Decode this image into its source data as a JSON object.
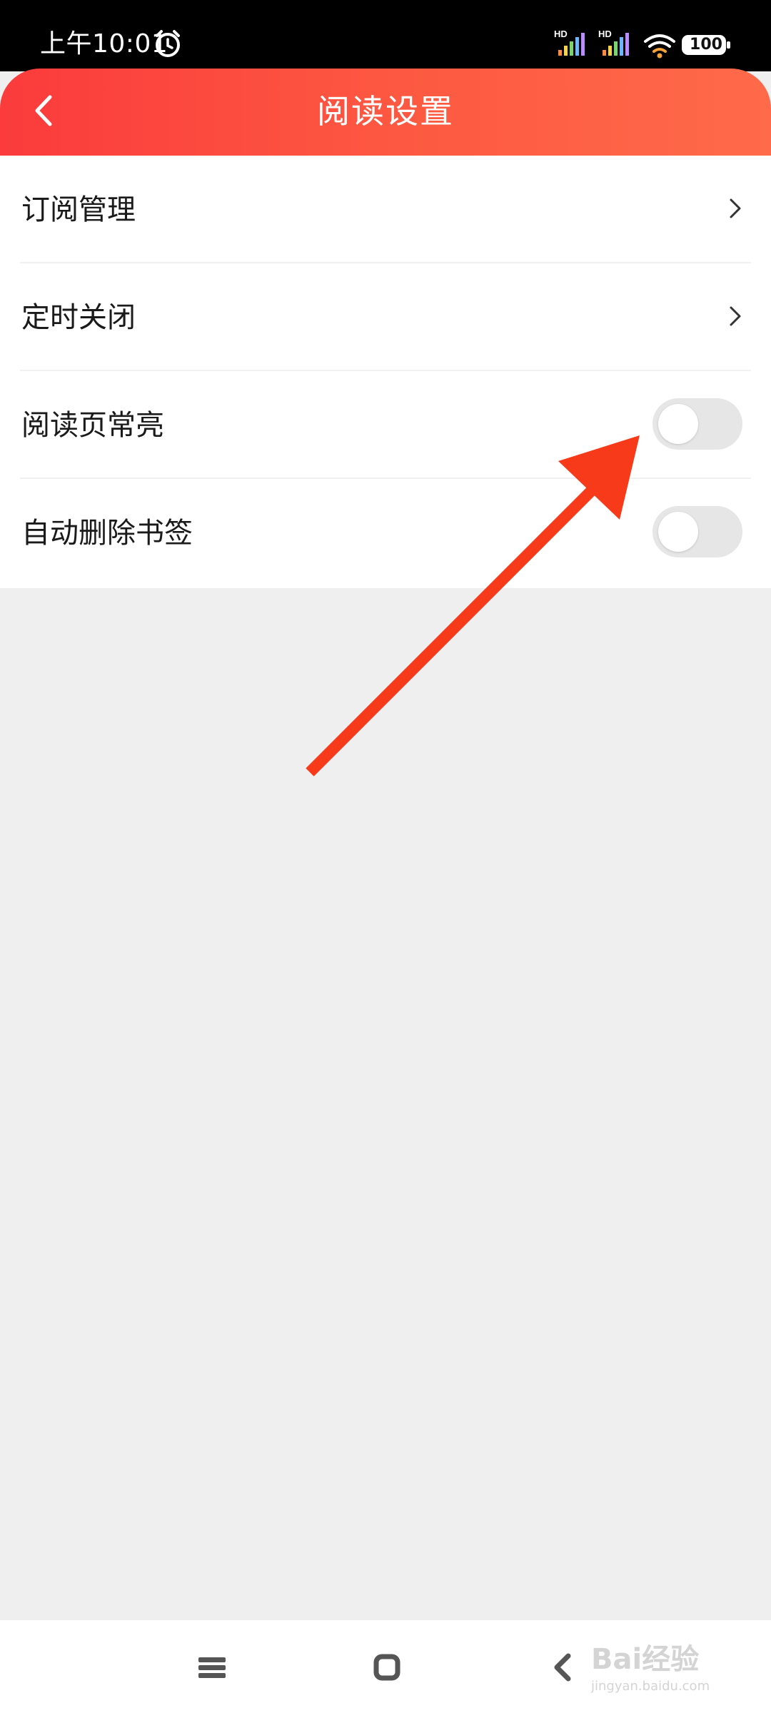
{
  "status_bar": {
    "time": "上午10:01",
    "battery": "100",
    "signal_label": "HD"
  },
  "header": {
    "title": "阅读设置",
    "background_from": "#fb3b3c",
    "background_to": "#ff6a4a"
  },
  "settings": {
    "items": [
      {
        "label": "订阅管理",
        "control": "chevron-right-icon"
      },
      {
        "label": "定时关闭",
        "control": "chevron-right-icon"
      },
      {
        "label": "阅读页常亮",
        "control": "toggle",
        "checked": false
      },
      {
        "label": "自动删除书签",
        "control": "toggle",
        "checked": false
      }
    ]
  },
  "annotation": {
    "arrow_color": "#f63a1a"
  },
  "nav_bar": {
    "icons": [
      "menu-icon",
      "home-icon",
      "back-icon"
    ]
  },
  "watermark": {
    "text": "Bai经验",
    "sub": "jingyan.baidu.com"
  }
}
